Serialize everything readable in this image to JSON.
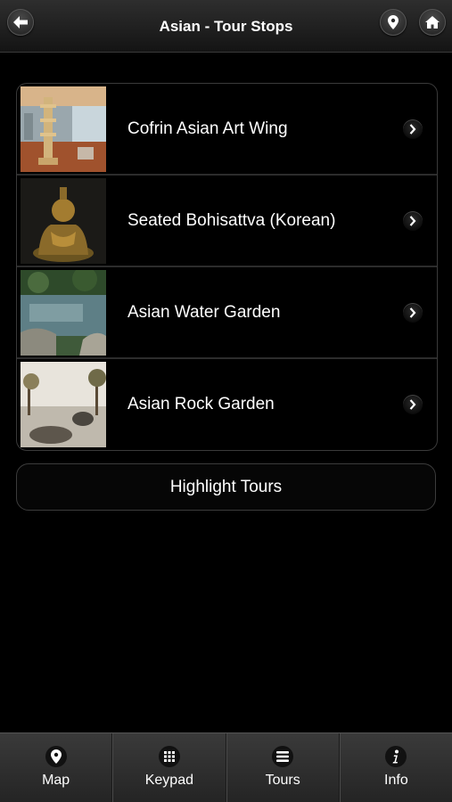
{
  "header": {
    "title": "Asian - Tour Stops",
    "back_icon": "arrow-left-icon",
    "location_icon": "map-pin-icon",
    "home_icon": "home-icon"
  },
  "stops": [
    {
      "label": "Cofrin Asian Art Wing",
      "thumb": "gallery-interior-pagoda"
    },
    {
      "label": "Seated Bohisattva (Korean)",
      "thumb": "golden-bodhisattva-statue"
    },
    {
      "label": "Asian Water Garden",
      "thumb": "water-garden-pond"
    },
    {
      "label": "Asian Rock Garden",
      "thumb": "rock-garden-trees"
    }
  ],
  "highlight_button": {
    "label": "Highlight Tours"
  },
  "tabbar": {
    "tabs": [
      {
        "label": "Map",
        "icon": "map-pin-icon"
      },
      {
        "label": "Keypad",
        "icon": "keypad-grid-icon"
      },
      {
        "label": "Tours",
        "icon": "list-icon"
      },
      {
        "label": "Info",
        "icon": "info-icon"
      }
    ]
  },
  "colors": {
    "background": "#000000",
    "header_top": "#2e2e2e",
    "header_bottom": "#141414",
    "row_divider": "#2c2c2c",
    "tabbar": "#2f2f2f"
  }
}
